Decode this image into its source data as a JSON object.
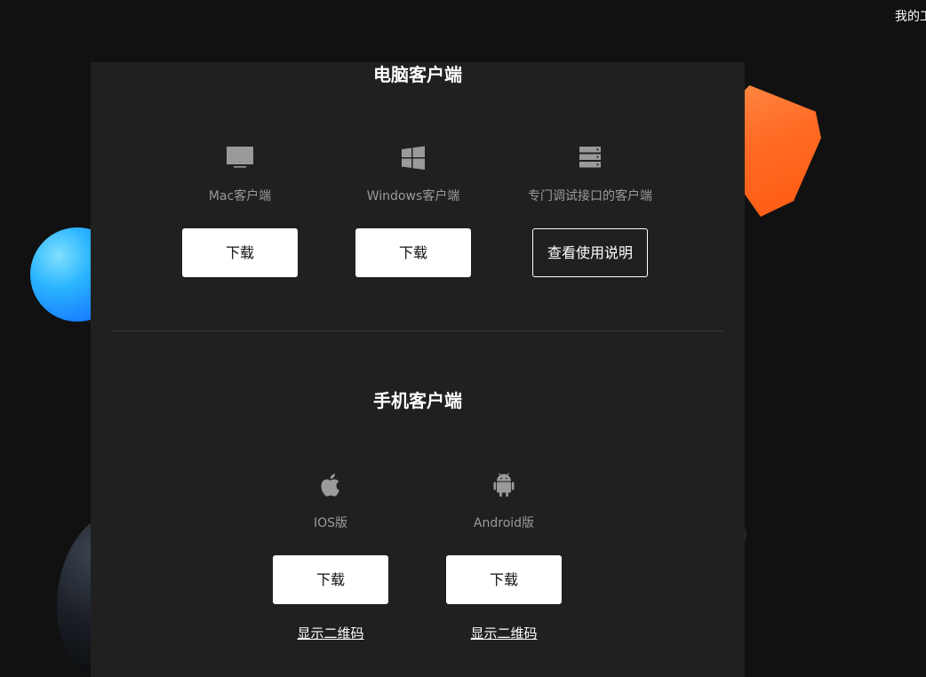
{
  "header": {
    "account_link": "我的工"
  },
  "desktop": {
    "title": "电脑客户端",
    "clients": [
      {
        "icon": "monitor-icon",
        "label": "Mac客户端",
        "button": "下载"
      },
      {
        "icon": "windows-icon",
        "label": "Windows客户端",
        "button": "下载"
      },
      {
        "icon": "server-icon",
        "label": "专门调试接口的客户端",
        "button": "查看使用说明"
      }
    ]
  },
  "mobile": {
    "title": "手机客户端",
    "clients": [
      {
        "icon": "apple-icon",
        "label": "IOS版",
        "button": "下载",
        "qr_link": "显示二维码"
      },
      {
        "icon": "android-icon",
        "label": "Android版",
        "button": "下载",
        "qr_link": "显示二维码"
      }
    ]
  },
  "colors": {
    "panel_bg": "#202020",
    "page_bg": "#111111",
    "button_bg": "#ffffff",
    "label_gray": "#9a9a9a",
    "accent_orange": "#ff6a24",
    "accent_blue": "#1f9bff"
  }
}
